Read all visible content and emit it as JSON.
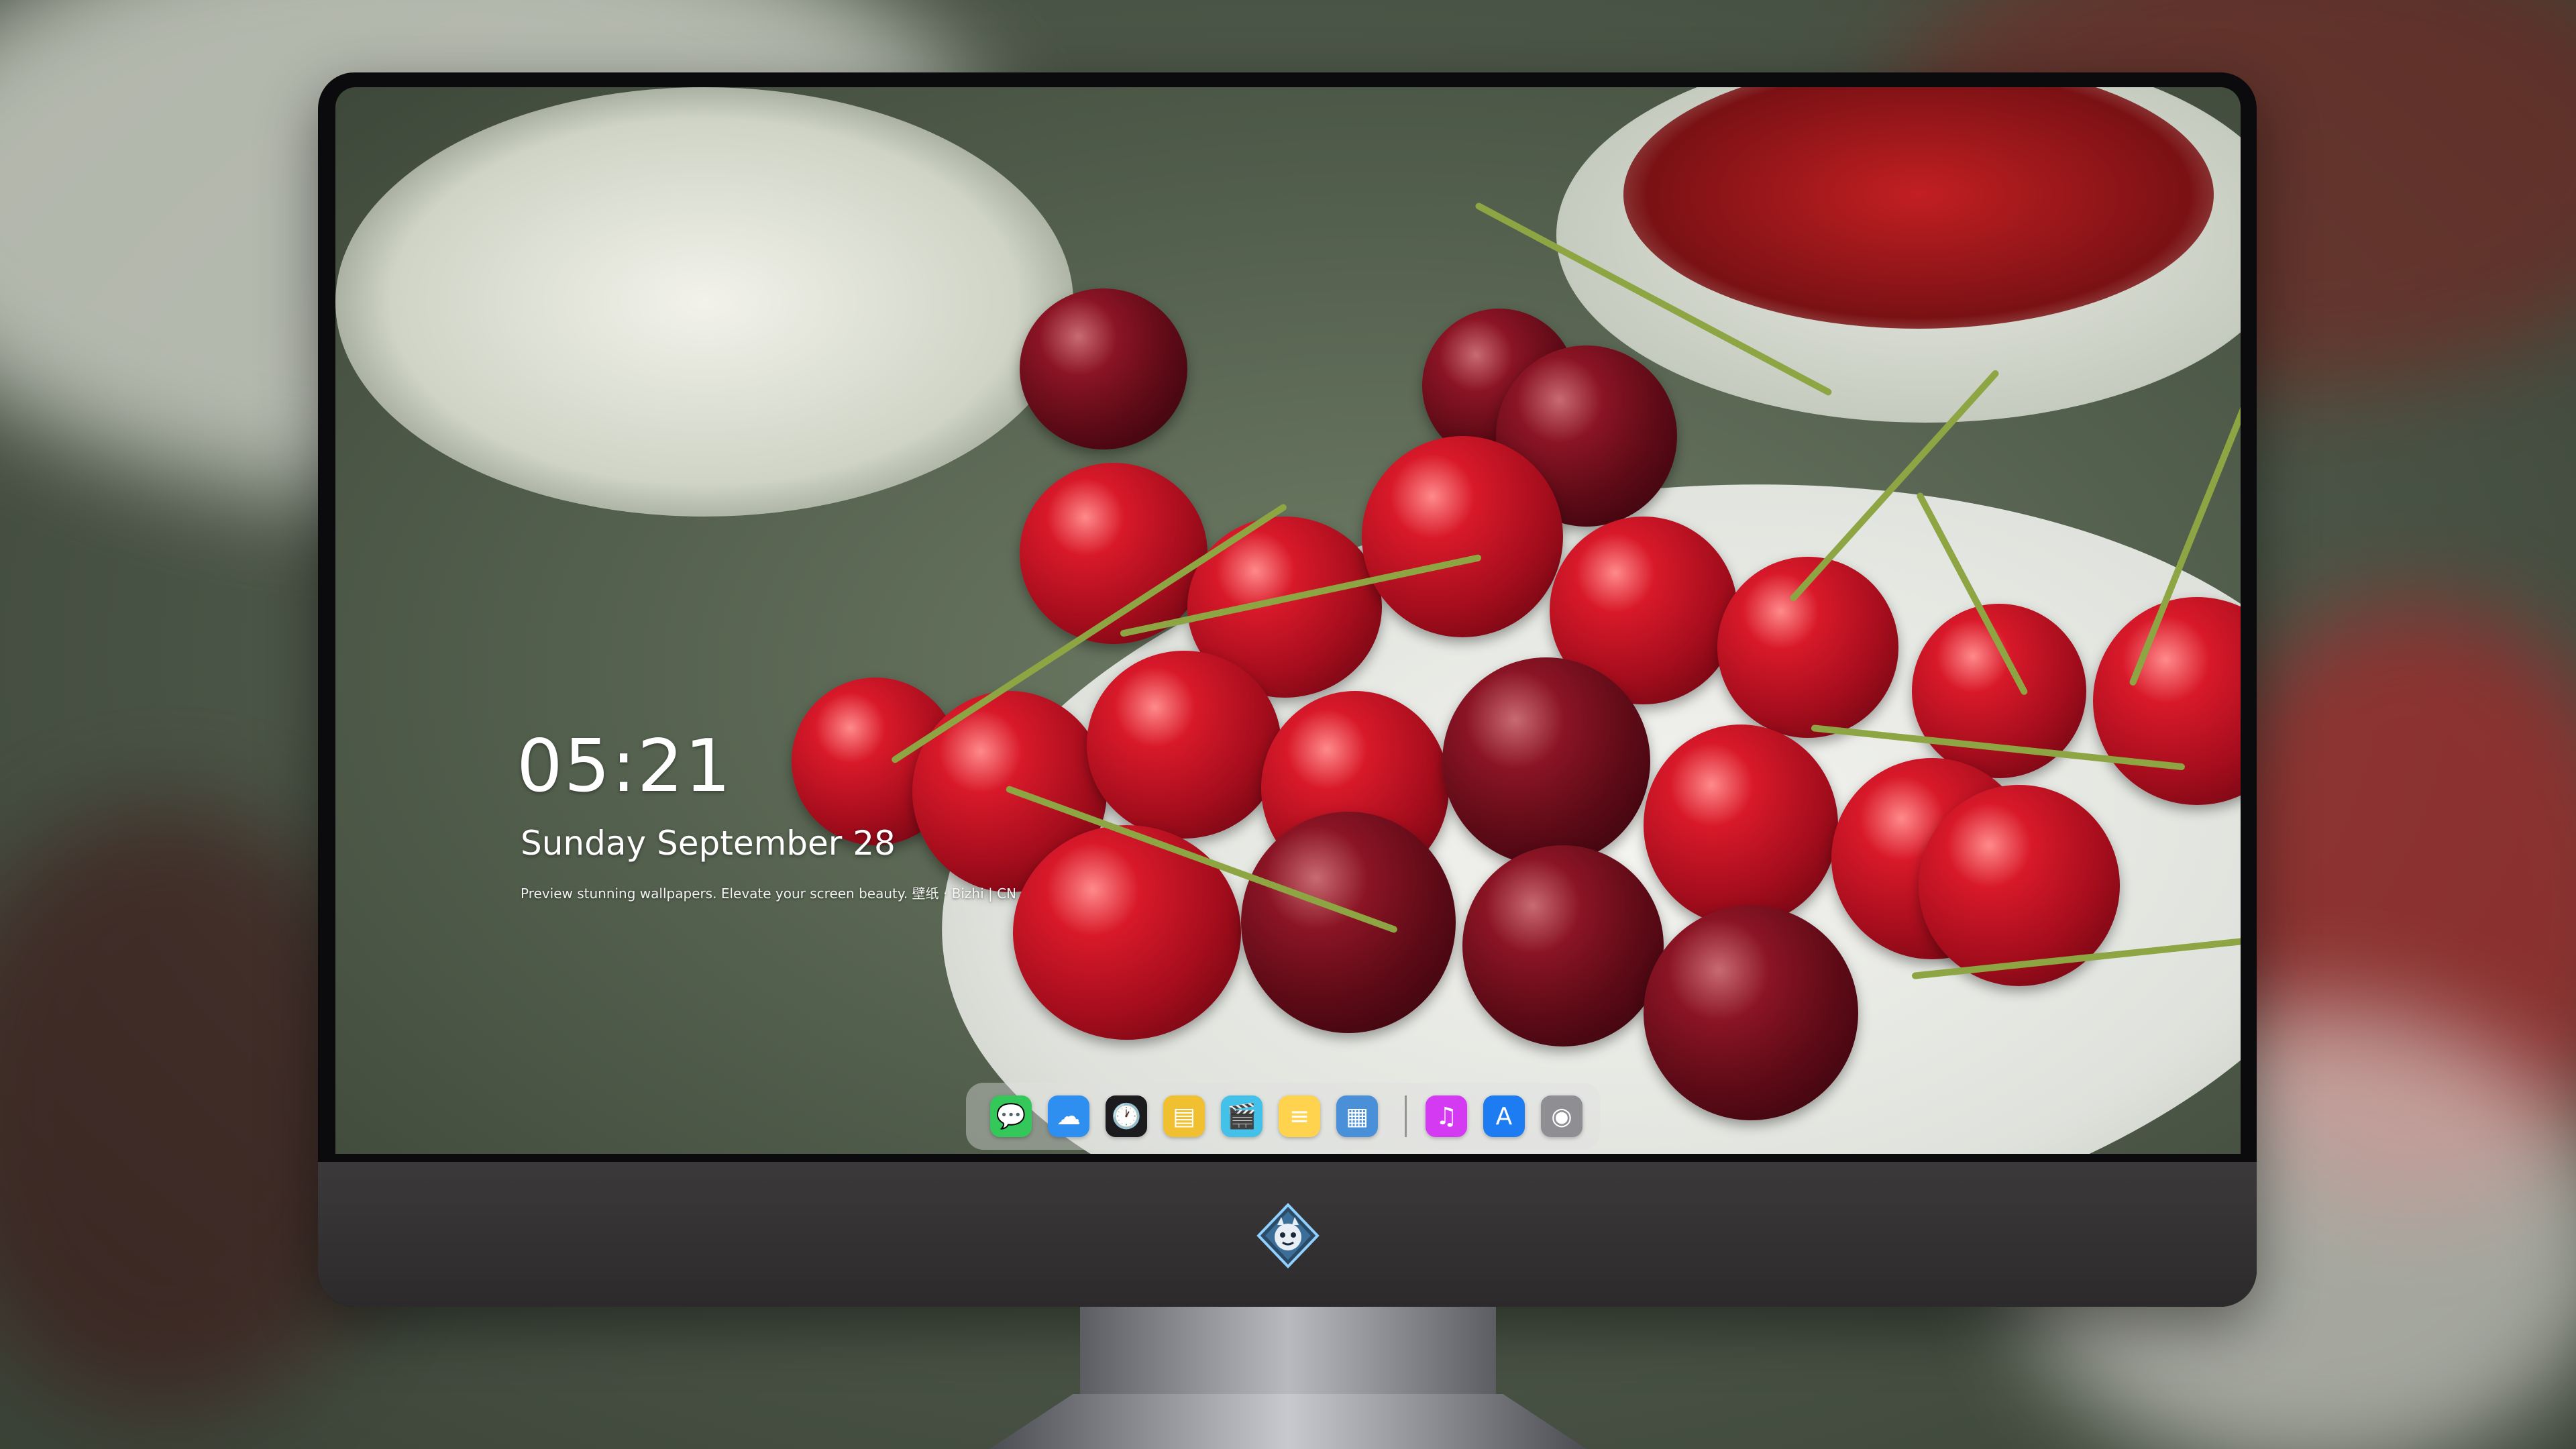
{
  "lock_screen": {
    "time": "05:21",
    "date": "Sunday September  28",
    "tagline": "Preview stunning wallpapers. Elevate your screen beauty. 壁纸 · Bizhi | CN"
  },
  "dock": {
    "apps": [
      {
        "name": "Messages",
        "icon": "message-bubble-icon",
        "glyph": "💬",
        "color": "#34c759"
      },
      {
        "name": "Weather",
        "icon": "weather-cloud-icon",
        "glyph": "☁",
        "color": "#2f8ff0"
      },
      {
        "name": "Clock",
        "icon": "clock-icon",
        "glyph": "🕐",
        "color": "#1c1c1e"
      },
      {
        "name": "Preview",
        "icon": "preview-icon",
        "glyph": "▤",
        "color": "#f0c030"
      },
      {
        "name": "Clips",
        "icon": "clapperboard-icon",
        "glyph": "🎬",
        "color": "#43c1e8"
      },
      {
        "name": "Notes",
        "icon": "notes-icon",
        "glyph": "≡",
        "color": "#ffd34e"
      },
      {
        "name": "Photo Booth",
        "icon": "photos-grid-icon",
        "glyph": "▦",
        "color": "#4a90d9"
      },
      {
        "name": "Music",
        "icon": "music-note-icon",
        "glyph": "♫",
        "color": "#d53af3"
      },
      {
        "name": "App Store",
        "icon": "app-store-icon",
        "glyph": "A",
        "color": "#1d7cf2"
      },
      {
        "name": "Camera",
        "icon": "camera-icon",
        "glyph": "◉",
        "color": "#8e8e93"
      }
    ],
    "separator_after_index": 6
  },
  "brand_logo": "dragon-mascot-logo-icon"
}
